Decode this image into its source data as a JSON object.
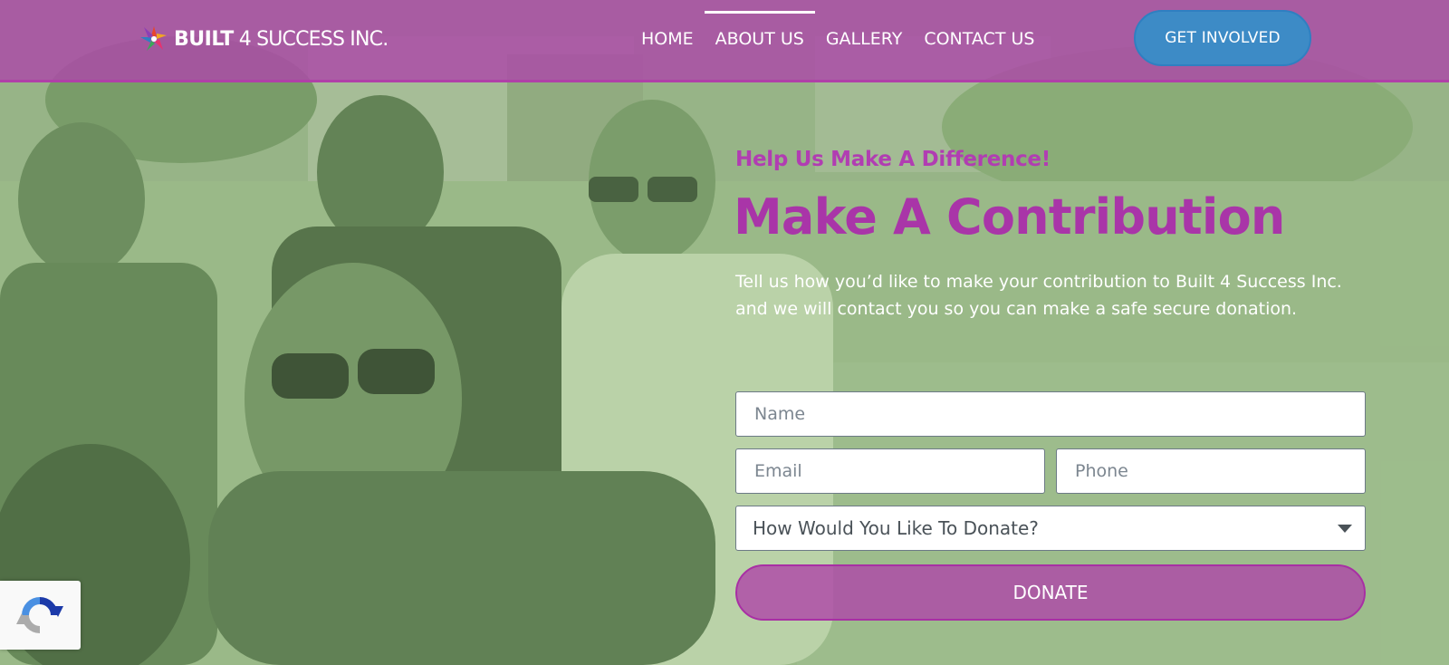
{
  "brand": {
    "name_bold": "BUILT",
    "name_light": "4 SUCCESS INC."
  },
  "nav": {
    "items": [
      {
        "label": "HOME",
        "active": false
      },
      {
        "label": "ABOUT US",
        "active": true
      },
      {
        "label": "GALLERY",
        "active": false
      },
      {
        "label": "CONTACT US",
        "active": false
      }
    ],
    "cta_label": "GET INVOLVED"
  },
  "hero": {
    "eyebrow": "Help Us Make A Difference!",
    "title": "Make A Contribution",
    "description": "Tell us how you’d like to make your contribution to Built 4 Success Inc. and we will contact you so you can make a safe secure donation."
  },
  "form": {
    "name_placeholder": "Name",
    "email_placeholder": "Email",
    "phone_placeholder": "Phone",
    "donate_method_selected": "How Would You Like To Donate?",
    "submit_label": "DONATE"
  },
  "colors": {
    "header": "#ac48a8",
    "accent_purple": "#a935a8",
    "cta_blue": "#3d8bc6",
    "overlay_green": "#8fae7f"
  },
  "icons": {
    "logo": "starburst-logo-icon",
    "select_caret": "chevron-down-icon",
    "recaptcha": "recaptcha-icon"
  }
}
